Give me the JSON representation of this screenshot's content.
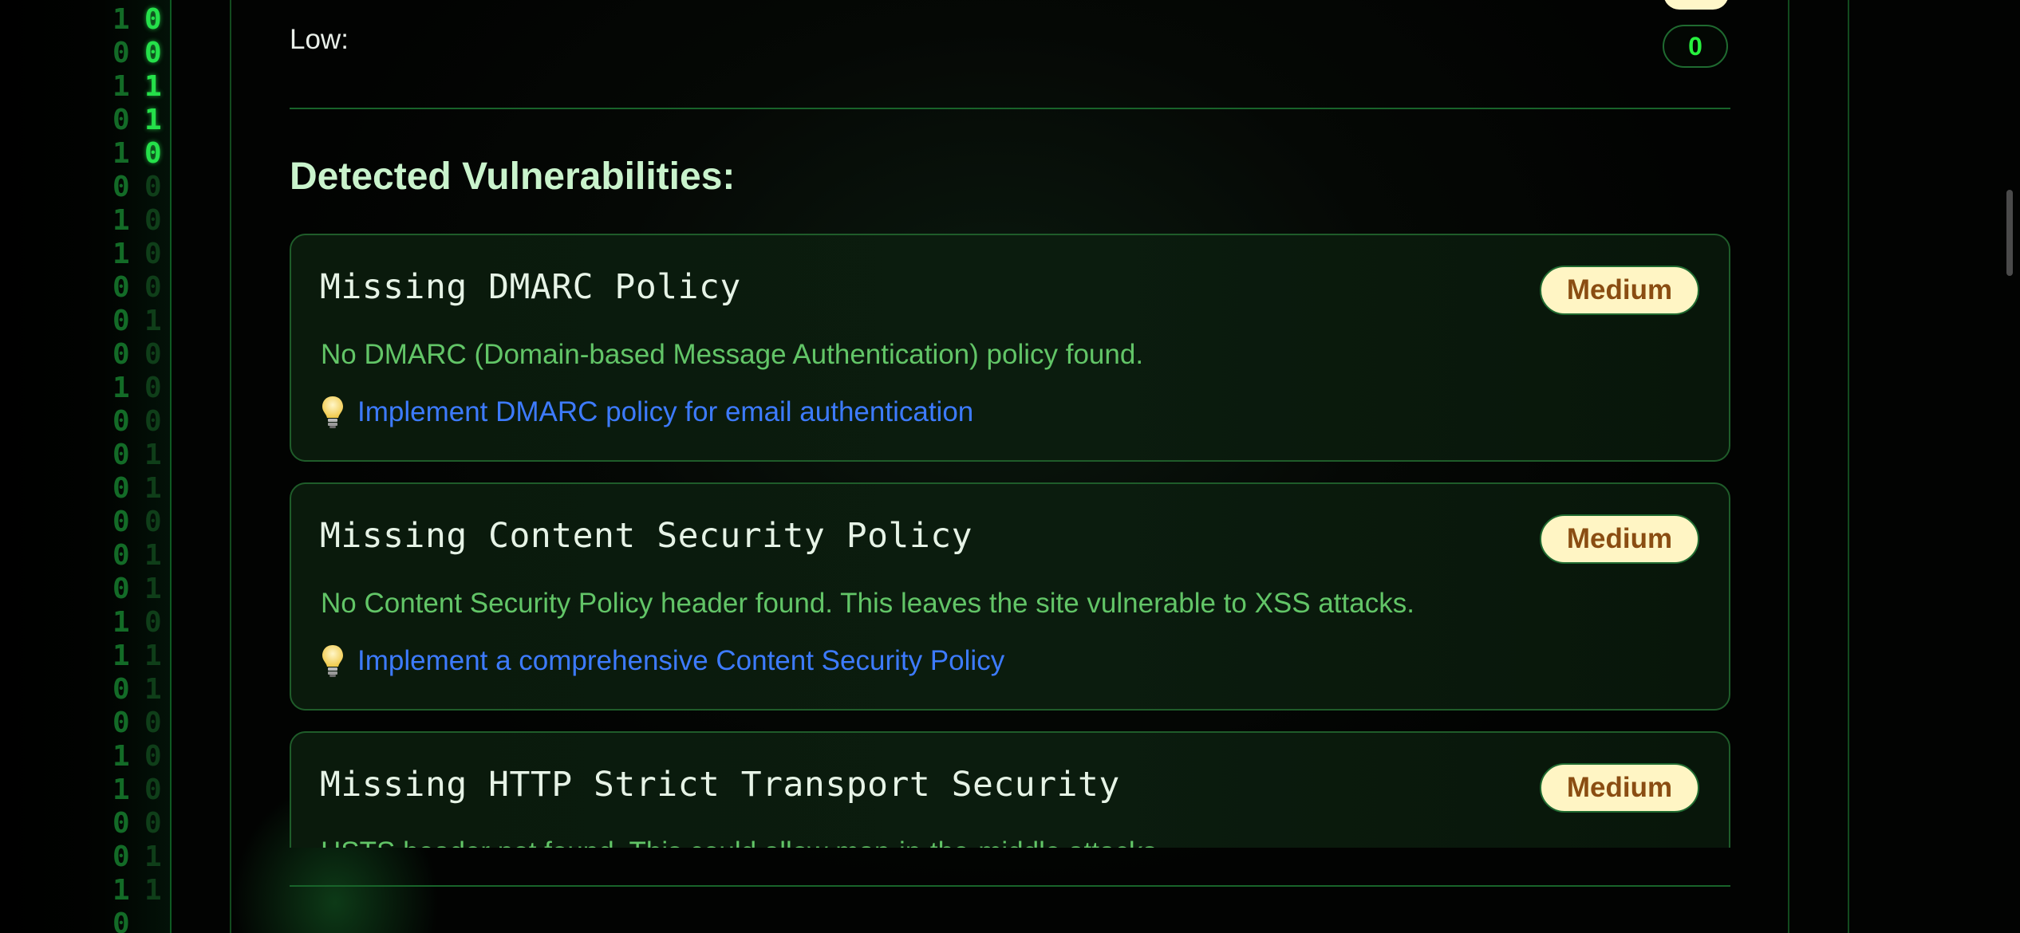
{
  "summary": {
    "low_label": "Low:",
    "low_count": "0"
  },
  "section_title": "Detected Vulnerabilities:",
  "vulnerabilities": [
    {
      "title": "Missing DMARC Policy",
      "severity": "Medium",
      "description": "No DMARC (Domain-based Message Authentication) policy found.",
      "recommendation": "Implement DMARC policy for email authentication"
    },
    {
      "title": "Missing Content Security Policy",
      "severity": "Medium",
      "description": "No Content Security Policy header found. This leaves the site vulnerable to XSS attacks.",
      "recommendation": "Implement a comprehensive Content Security Policy"
    },
    {
      "title": "Missing HTTP Strict Transport Security",
      "severity": "Medium",
      "description": "HSTS header not found. This could allow man-in-the-middle attacks."
    }
  ],
  "matrix_rain": {
    "column_a": "1\n0\n1\n0\n1\n0\n1\n1\n0\n0\n0\n1\n0\n0\n0\n0\n0\n0\n1\n1\n0\n0\n1\n1\n0\n0\n1\n0",
    "column_b": "0\n0\n1\n1\n0\n0\n0\n0\n0\n1\n0\n0\n0\n1\n1\n0\n1\n1\n0\n1\n1\n0\n0\n0\n0\n1\n1",
    "color_dim": "#136b27",
    "color_hot": "#25e04a"
  },
  "colors": {
    "badge_medium_bg": "#fff5c4",
    "badge_medium_text": "#8a4d12",
    "count_low": "#27f03e",
    "description_text": "#62c567",
    "recommendation_link": "#3d7bff"
  },
  "icons": {
    "recommendation": "lightbulb-icon"
  }
}
